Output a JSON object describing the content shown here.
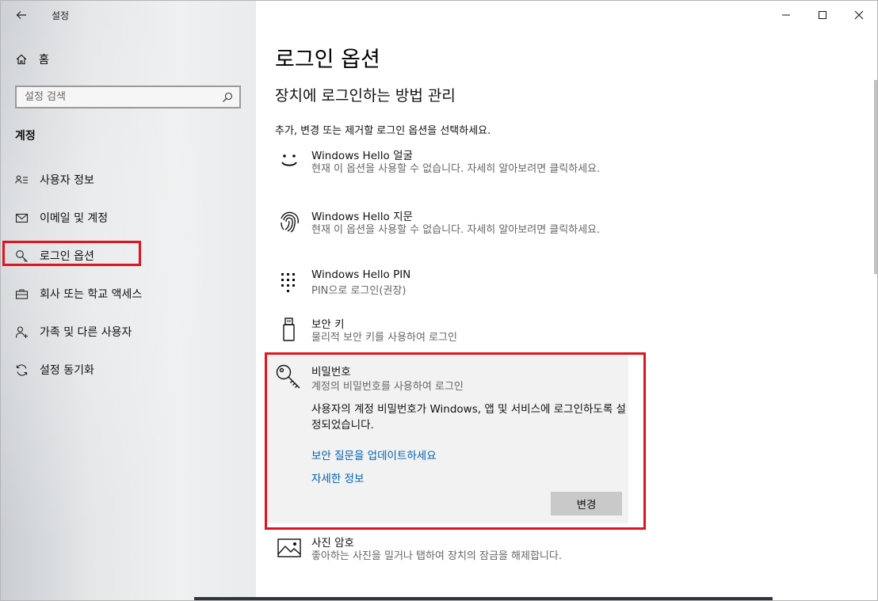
{
  "app": {
    "title": "설정"
  },
  "sidebar": {
    "home_label": "홈",
    "search_placeholder": "설정 검색",
    "section_label": "계정",
    "items": [
      {
        "label": "사용자 정보",
        "icon": "user-info-icon"
      },
      {
        "label": "이메일 및 계정",
        "icon": "mail-icon"
      },
      {
        "label": "로그인 옵션",
        "icon": "key-icon",
        "selected": true
      },
      {
        "label": "회사 또는 학교 액세스",
        "icon": "briefcase-icon"
      },
      {
        "label": "가족 및 다른 사용자",
        "icon": "person-add-icon"
      },
      {
        "label": "설정 동기화",
        "icon": "sync-icon"
      }
    ]
  },
  "main": {
    "title": "로그인 옵션",
    "subtitle": "장치에 로그인하는 방법 관리",
    "instruction": "추가, 변경 또는 제거할 로그인 옵션을 선택하세요.",
    "options": [
      {
        "title": "Windows Hello 얼굴",
        "desc": "현재 이 옵션을 사용할 수 없습니다. 자세히 알아보려면 클릭하세요.",
        "icon": "face-icon"
      },
      {
        "title": "Windows Hello 지문",
        "desc": "현재 이 옵션을 사용할 수 없습니다. 자세히 알아보려면 클릭하세요.",
        "icon": "fingerprint-icon"
      },
      {
        "title": "Windows Hello PIN",
        "desc": "PIN으로 로그인(권장)",
        "icon": "pin-keypad-icon"
      },
      {
        "title": "보안 키",
        "desc": "물리적 보안 키를 사용하여 로그인",
        "icon": "usb-key-icon"
      },
      {
        "title": "사진 암호",
        "desc": "좋아하는 사진을 밀거나 탭하여 장치의 잠금을 해제합니다.",
        "icon": "picture-icon"
      }
    ],
    "password": {
      "title": "비밀번호",
      "desc": "계정의 비밀번호를 사용하여 로그인",
      "info": "사용자의 계정 비밀번호가 Windows, 앱 및 서비스에 로그인하도록 설정되었습니다.",
      "link_update": "보안 질문을 업데이트하세요",
      "link_more": "자세한 정보",
      "change_button": "변경"
    }
  },
  "colors": {
    "highlight": "#e0141e",
    "link": "#0062b5"
  }
}
